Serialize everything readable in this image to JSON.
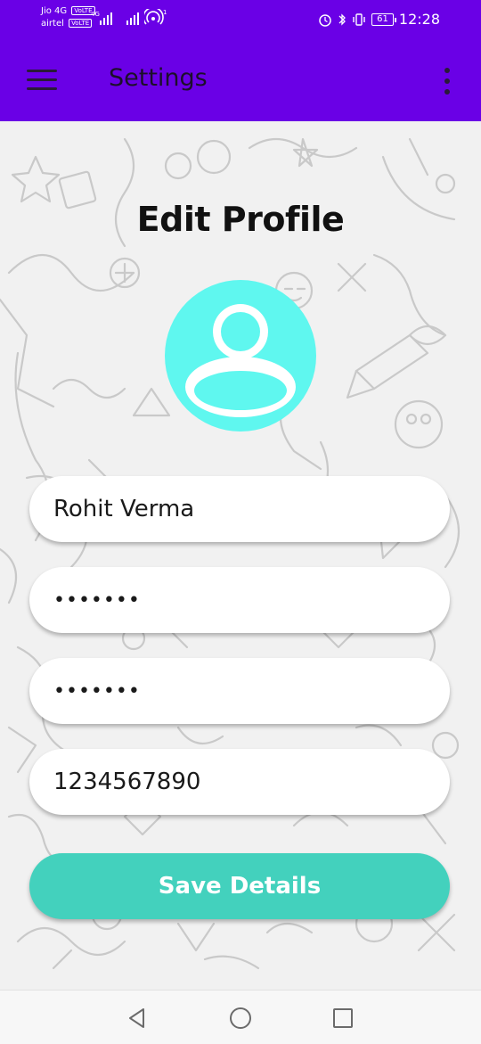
{
  "status_bar": {
    "carrier1": "Jio 4G",
    "carrier2": "airtel",
    "volte": "VoLTE",
    "net": "4G",
    "sim_count": "1",
    "battery": "61",
    "time": "12:28"
  },
  "app_bar": {
    "title": "Settings",
    "menu_icon": "hamburger-menu-icon",
    "overflow_icon": "more-vert-icon"
  },
  "profile": {
    "heading": "Edit Profile",
    "avatar_icon": "person-icon",
    "avatar_color": "#5ff7ef"
  },
  "form": {
    "name": "Rohit Verma",
    "password": "•••••••",
    "confirm_password": "•••••••",
    "phone": "1234567890",
    "save_label": "Save Details"
  },
  "colors": {
    "primary": "#6a00e6",
    "accent": "#43d1bd",
    "avatar": "#5ff7ef"
  },
  "nav": {
    "back_icon": "back-triangle-icon",
    "home_icon": "home-circle-icon",
    "recents_icon": "recents-square-icon"
  }
}
